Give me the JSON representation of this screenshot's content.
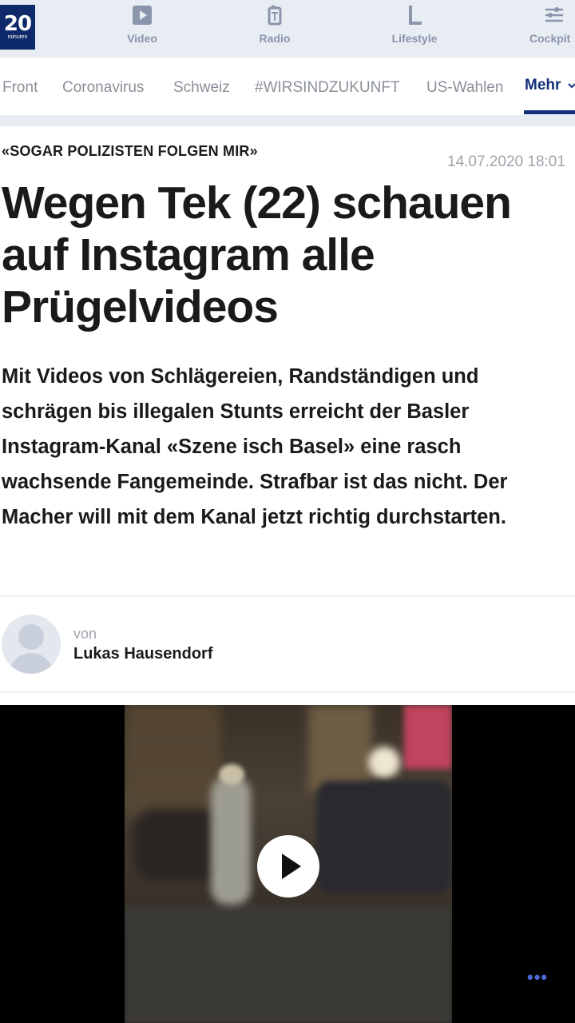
{
  "app": {
    "logo_number": "20",
    "logo_sub": "minuten"
  },
  "topnav": [
    {
      "label": "Video",
      "icon": "video-icon"
    },
    {
      "label": "Radio",
      "icon": "radio-icon"
    },
    {
      "label": "Lifestyle",
      "icon": "lifestyle-icon"
    },
    {
      "label": "Cockpit",
      "icon": "cockpit-icon"
    }
  ],
  "sections": [
    {
      "label": "Front"
    },
    {
      "label": "Coronavirus"
    },
    {
      "label": "Schweiz"
    },
    {
      "label": "#WIRSINDZUKUNFT"
    },
    {
      "label": "US-Wahlen"
    },
    {
      "label": "Mehr",
      "active": true
    }
  ],
  "article": {
    "kicker": "«SOGAR POLIZISTEN FOLGEN MIR»",
    "date": "14.07.2020 18:01",
    "headline": "Wegen Tek (22) schauen auf Instagram alle Prügelvideos",
    "lead": "Mit Videos von Schlägereien, Randständigen und schrägen bis illegalen Stunts erreicht der Basler Instagram-Kanal «Szene isch Basel» eine rasch wachsende Fangemeinde. Strafbar ist das nicht. Der Macher will mit dem Kanal jetzt richtig durchstarten.",
    "author_prefix": "von",
    "author": "Lukas Hausendorf"
  },
  "video": {
    "more_dots": "•••"
  },
  "colors": {
    "brand": "#0e2a6b",
    "nav_active": "#14307a",
    "nav_bg": "#e8ecf3",
    "more_dots": "#4a6ad8"
  }
}
